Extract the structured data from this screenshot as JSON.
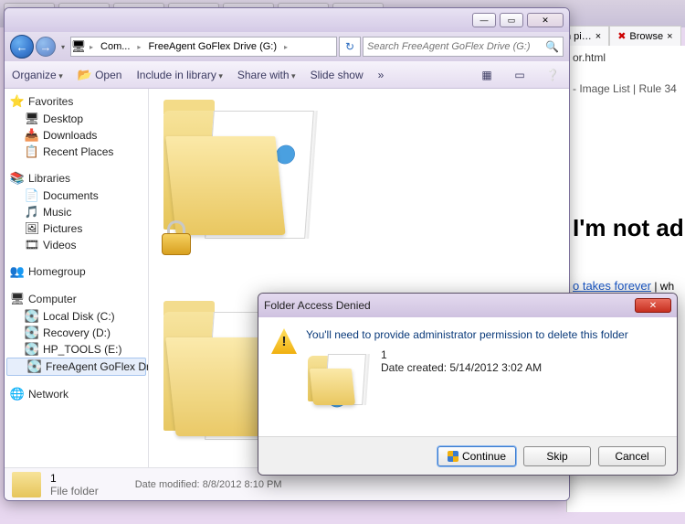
{
  "background": {
    "tabs": [
      {
        "label": "n pi…",
        "icon": "x"
      },
      {
        "label": "Browse",
        "icon": "x"
      }
    ],
    "url": "or.html",
    "links": "- Image List   |   Rule 34",
    "headline": "I'm not ad",
    "link1": "o takes forever",
    "link1_after": " | wh"
  },
  "explorer": {
    "breadcrumb": {
      "root_icon": "computer",
      "seg1": "Com...",
      "seg2": "FreeAgent GoFlex Drive (G:)"
    },
    "search_placeholder": "Search FreeAgent GoFlex Drive (G:)",
    "cmdbar": {
      "organize": "Organize",
      "open": "Open",
      "include": "Include in library",
      "share": "Share with",
      "slideshow": "Slide show",
      "more": "»"
    },
    "nav": {
      "favorites": {
        "label": "Favorites",
        "items": [
          "Desktop",
          "Downloads",
          "Recent Places"
        ]
      },
      "libraries": {
        "label": "Libraries",
        "items": [
          "Documents",
          "Music",
          "Pictures",
          "Videos"
        ]
      },
      "homegroup": {
        "label": "Homegroup"
      },
      "computer": {
        "label": "Computer",
        "items": [
          "Local Disk (C:)",
          "Recovery (D:)",
          "HP_TOOLS (E:)",
          "FreeAgent GoFlex Dr"
        ]
      },
      "network": {
        "label": "Network"
      }
    },
    "details": {
      "name": "1",
      "type": "File folder",
      "meta_label": "Date modified:",
      "meta_value": "8/8/2012 8:10 PM"
    }
  },
  "dialog": {
    "title": "Folder Access Denied",
    "message": "You'll need to provide administrator permission to delete this folder",
    "item_name": "1",
    "item_meta": "Date created: 5/14/2012 3:02 AM",
    "buttons": {
      "continue": "Continue",
      "skip": "Skip",
      "cancel": "Cancel"
    }
  }
}
